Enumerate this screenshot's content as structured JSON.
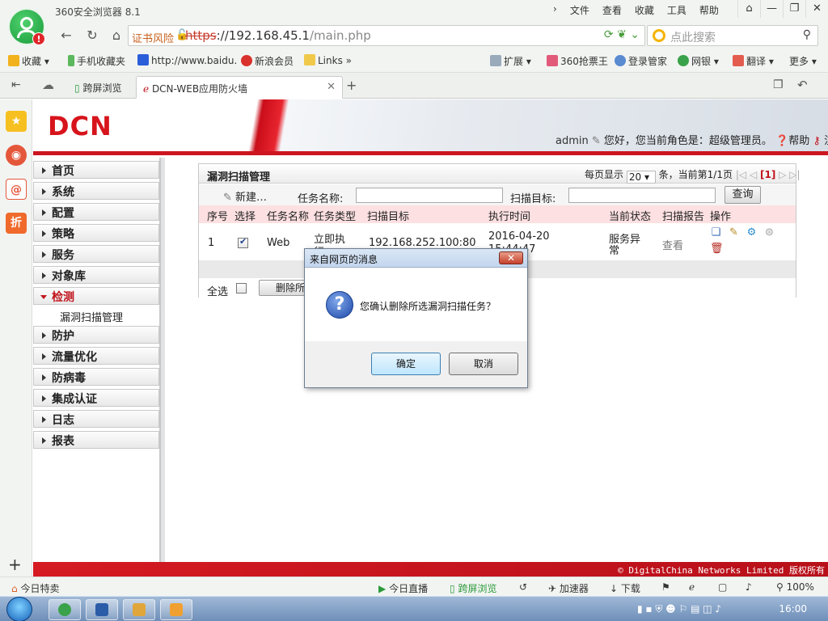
{
  "browser": {
    "app_title": "360安全浏览器 8.1",
    "menu": [
      "文件",
      "查看",
      "收藏",
      "工具",
      "帮助"
    ],
    "window_buttons": [
      "⌂",
      "—",
      "❐",
      "✕"
    ],
    "cert_warning": "证书风险",
    "url_scheme": "https",
    "url_host": "://192.168.45.1",
    "url_path": "/main.php",
    "search_placeholder": "点此搜索",
    "favorites": [
      "收藏",
      "手机收藏夹",
      "http://www.baidu.",
      "新浪会员",
      "Links",
      "扩展",
      "360抢票王",
      "登录管家",
      "网银",
      "翻译",
      "更多"
    ],
    "tabs": [
      {
        "label": "跨屏浏览"
      },
      {
        "label": "DCN-WEB应用防火墙"
      }
    ],
    "status_left": "今日特卖",
    "status_items": [
      "今日直播",
      "跨屏浏览",
      "加速器",
      "下载",
      "100%"
    ],
    "sidebar_icons": [
      "star-icon",
      "weibo-icon",
      "mail-icon",
      "discount-icon"
    ],
    "discount_label": "折"
  },
  "page": {
    "logo_text": "DCN",
    "user": "admin",
    "greeting": "您好，您当前角色是：超级管理员。",
    "help": "帮助",
    "logout": "注销",
    "copyright": "© DigitalChina Networks Limited 版权所有"
  },
  "nav": {
    "items": [
      "首页",
      "系统",
      "配置",
      "策略",
      "服务",
      "对象库",
      "检测",
      "防护",
      "流量优化",
      "防病毒",
      "集成认证",
      "日志",
      "报表"
    ],
    "open_index": 6,
    "sub_item": "漏洞扫描管理"
  },
  "panel": {
    "title": "漏洞扫描管理",
    "per_page_label": "每页显示",
    "per_page_value": "20",
    "page_info": "条，当前第1/1页",
    "current_page": "[1]",
    "new_button": "新建…",
    "task_name_label": "任务名称:",
    "scan_target_label": "扫描目标:",
    "query_button": "查询",
    "columns": [
      "序号",
      "选择",
      "任务名称",
      "任务类型",
      "扫描目标",
      "执行时间",
      "当前状态",
      "扫描报告",
      "操作"
    ],
    "rows": [
      {
        "index": "1",
        "selected": true,
        "name": "Web",
        "type_line1": "立即执",
        "type_line2": "行",
        "target": "192.168.252.100:80",
        "time_line1": "2016-04-20",
        "time_line2": "15:44:47",
        "status_line1": "服务异",
        "status_line2": "常",
        "report": "查看"
      }
    ],
    "select_all": "全选",
    "delete_button": "删除所"
  },
  "dialog": {
    "title": "来自网页的消息",
    "message": "您确认删除所选漏洞扫描任务？",
    "ok": "确定",
    "cancel": "取消"
  },
  "taskbar": {
    "clock": "16:00"
  }
}
